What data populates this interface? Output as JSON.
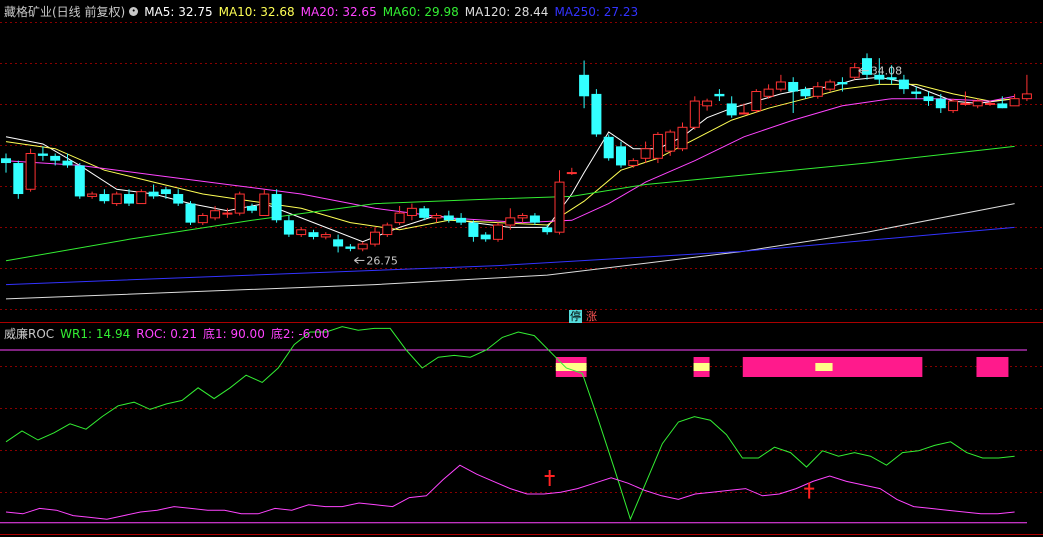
{
  "main_legend": {
    "title": "藏格矿业(日线 前复权)",
    "items": [
      {
        "label": "MA5: 32.75",
        "color": "#ffffff"
      },
      {
        "label": "MA10: 32.68",
        "color": "#ffff55"
      },
      {
        "label": "MA20: 32.65",
        "color": "#ff44ff"
      },
      {
        "label": "MA60: 29.98",
        "color": "#33ee33"
      },
      {
        "label": "MA120: 28.44",
        "color": "#dddddd"
      },
      {
        "label": "MA250: 27.23",
        "color": "#3333ff"
      }
    ]
  },
  "sub_legend": {
    "title": "威廉ROC",
    "items": [
      {
        "label": "WR1: 14.94",
        "color": "#33ee33"
      },
      {
        "label": "ROC: 0.21",
        "color": "#ff44ff"
      },
      {
        "label": "底1: 90.00",
        "color": "#ff44ff"
      },
      {
        "label": "底2: -6.00",
        "color": "#ff44ff"
      }
    ]
  },
  "badges": {
    "ting": "停",
    "zhang": "涨"
  },
  "annotations": {
    "high_label": "34.08",
    "low_label": "26.75"
  },
  "colors": {
    "up": "#ff3333",
    "down": "#33ffff",
    "grid": "#880000",
    "bg": "#000000"
  },
  "chart_data": [
    {
      "type": "candlestick",
      "title": "藏格矿业(日线 前复权)",
      "ylim": [
        24.0,
        36.5
      ],
      "candles": [
        [
          30.7,
          30.9,
          30.1,
          30.5
        ],
        [
          30.5,
          30.6,
          29.0,
          29.2
        ],
        [
          29.4,
          31.1,
          29.3,
          30.9
        ],
        [
          30.9,
          31.2,
          30.6,
          30.8
        ],
        [
          30.8,
          30.9,
          30.4,
          30.6
        ],
        [
          30.6,
          30.9,
          30.3,
          30.4
        ],
        [
          30.4,
          30.5,
          29.0,
          29.1
        ],
        [
          29.1,
          29.3,
          29.0,
          29.2
        ],
        [
          29.2,
          29.4,
          28.8,
          28.9
        ],
        [
          28.8,
          29.3,
          28.7,
          29.2
        ],
        [
          29.2,
          29.4,
          28.7,
          28.8
        ],
        [
          28.8,
          29.4,
          28.8,
          29.3
        ],
        [
          29.3,
          29.6,
          29.0,
          29.1
        ],
        [
          29.4,
          29.5,
          29.0,
          29.2
        ],
        [
          29.2,
          29.4,
          28.7,
          28.8
        ],
        [
          28.8,
          28.9,
          27.9,
          28.0
        ],
        [
          28.0,
          28.4,
          27.9,
          28.3
        ],
        [
          28.2,
          28.7,
          28.1,
          28.5
        ],
        [
          28.4,
          28.6,
          28.2,
          28.4
        ],
        [
          28.4,
          29.3,
          28.3,
          29.2
        ],
        [
          28.7,
          28.8,
          28.4,
          28.5
        ],
        [
          28.3,
          29.4,
          28.3,
          29.2
        ],
        [
          29.2,
          29.4,
          28.0,
          28.1
        ],
        [
          28.1,
          28.3,
          27.4,
          27.5
        ],
        [
          27.5,
          27.8,
          27.4,
          27.7
        ],
        [
          27.6,
          27.7,
          27.3,
          27.4
        ],
        [
          27.4,
          27.6,
          27.3,
          27.5
        ],
        [
          27.3,
          27.5,
          26.75,
          27.0
        ],
        [
          27.0,
          27.1,
          26.8,
          26.9
        ],
        [
          26.9,
          27.2,
          26.8,
          27.1
        ],
        [
          27.1,
          27.8,
          27.0,
          27.6
        ],
        [
          27.5,
          28.0,
          27.4,
          27.9
        ],
        [
          28.0,
          28.7,
          27.9,
          28.4
        ],
        [
          28.3,
          28.8,
          28.1,
          28.6
        ],
        [
          28.6,
          28.7,
          28.1,
          28.2
        ],
        [
          28.2,
          28.4,
          28.0,
          28.3
        ],
        [
          28.3,
          28.5,
          28.0,
          28.1
        ],
        [
          28.2,
          28.4,
          27.9,
          28.0
        ],
        [
          28.0,
          28.1,
          27.2,
          27.4
        ],
        [
          27.5,
          27.6,
          27.2,
          27.3
        ],
        [
          27.3,
          28.0,
          27.2,
          27.9
        ],
        [
          27.9,
          28.6,
          27.7,
          28.2
        ],
        [
          28.2,
          28.4,
          28.0,
          28.3
        ],
        [
          28.3,
          28.4,
          27.9,
          28.0
        ],
        [
          27.8,
          27.9,
          27.5,
          27.6
        ],
        [
          27.6,
          30.2,
          27.5,
          29.7
        ],
        [
          30.1,
          30.3,
          30.0,
          30.1
        ],
        [
          34.2,
          34.8,
          32.8,
          33.3
        ],
        [
          33.4,
          33.6,
          31.6,
          31.7
        ],
        [
          31.6,
          31.7,
          30.6,
          30.7
        ],
        [
          31.2,
          31.4,
          30.3,
          30.4
        ],
        [
          30.4,
          30.7,
          30.3,
          30.6
        ],
        [
          30.7,
          31.4,
          30.5,
          31.1
        ],
        [
          30.7,
          31.8,
          30.5,
          31.7
        ],
        [
          31.0,
          31.9,
          30.8,
          31.8
        ],
        [
          31.1,
          32.2,
          31.0,
          32.0
        ],
        [
          32.0,
          33.3,
          31.9,
          33.1
        ],
        [
          32.9,
          33.2,
          32.7,
          33.1
        ],
        [
          33.4,
          33.6,
          33.1,
          33.3
        ],
        [
          33.0,
          33.3,
          32.4,
          32.5
        ],
        [
          32.6,
          33.0,
          32.6,
          32.6
        ],
        [
          32.7,
          33.6,
          32.6,
          33.5
        ],
        [
          33.3,
          33.8,
          33.2,
          33.6
        ],
        [
          33.6,
          34.2,
          33.5,
          33.9
        ],
        [
          33.9,
          34.1,
          32.6,
          33.5
        ],
        [
          33.6,
          33.7,
          33.2,
          33.3
        ],
        [
          33.3,
          33.9,
          33.2,
          33.7
        ],
        [
          33.6,
          34.0,
          33.5,
          33.9
        ],
        [
          33.9,
          34.1,
          33.5,
          33.8
        ],
        [
          34.1,
          34.7,
          34.0,
          34.5
        ],
        [
          34.9,
          35.1,
          34.0,
          34.2
        ],
        [
          34.2,
          34.9,
          33.8,
          34.0
        ],
        [
          34.1,
          34.6,
          33.8,
          34.0
        ],
        [
          34.0,
          34.2,
          33.4,
          33.6
        ],
        [
          33.5,
          33.7,
          33.2,
          33.4
        ],
        [
          33.3,
          33.5,
          32.9,
          33.1
        ],
        [
          33.2,
          33.4,
          32.6,
          32.8
        ],
        [
          32.7,
          33.2,
          32.6,
          33.1
        ],
        [
          33.0,
          33.5,
          32.9,
          33.0
        ],
        [
          32.9,
          33.2,
          32.8,
          33.1
        ],
        [
          33.0,
          33.1,
          32.9,
          33.0
        ],
        [
          33.0,
          33.3,
          32.8,
          32.8
        ],
        [
          32.9,
          33.4,
          32.9,
          33.2
        ],
        [
          33.2,
          34.2,
          33.1,
          33.4
        ]
      ],
      "ma": {
        "MA5": {
          "start": [
            30.9,
            30.3
          ],
          "end": [
            33.2,
            32.9
          ],
          "points": [
            [
              0,
              31.6
            ],
            [
              3,
              31.3
            ],
            [
              6,
              30.4
            ],
            [
              9,
              29.4
            ],
            [
              12,
              29.2
            ],
            [
              15,
              28.8
            ],
            [
              18,
              28.5
            ],
            [
              21,
              28.8
            ],
            [
              23,
              28.4
            ],
            [
              26,
              27.8
            ],
            [
              29,
              27.2
            ],
            [
              32,
              27.8
            ],
            [
              35,
              28.3
            ],
            [
              38,
              28.0
            ],
            [
              41,
              27.8
            ],
            [
              44,
              27.8
            ],
            [
              46,
              29.2
            ],
            [
              47,
              30.1
            ],
            [
              49,
              31.8
            ],
            [
              51,
              31.1
            ],
            [
              53,
              31.1
            ],
            [
              55,
              31.6
            ],
            [
              57,
              32.4
            ],
            [
              59,
              32.8
            ],
            [
              61,
              33.1
            ],
            [
              63,
              33.4
            ],
            [
              65,
              33.6
            ],
            [
              67,
              33.7
            ],
            [
              69,
              34.0
            ],
            [
              71,
              34.1
            ],
            [
              73,
              33.9
            ],
            [
              75,
              33.5
            ],
            [
              77,
              33.1
            ],
            [
              79,
              33.0
            ],
            [
              82,
              33.2
            ]
          ]
        },
        "MA10": {
          "points": [
            [
              0,
              31.4
            ],
            [
              4,
              31.1
            ],
            [
              8,
              30.2
            ],
            [
              12,
              29.7
            ],
            [
              16,
              29.2
            ],
            [
              20,
              28.9
            ],
            [
              24,
              28.6
            ],
            [
              28,
              28.0
            ],
            [
              32,
              27.7
            ],
            [
              36,
              28.1
            ],
            [
              40,
              28.0
            ],
            [
              44,
              27.9
            ],
            [
              47,
              28.9
            ],
            [
              50,
              30.2
            ],
            [
              53,
              30.7
            ],
            [
              56,
              31.5
            ],
            [
              59,
              32.3
            ],
            [
              62,
              32.8
            ],
            [
              65,
              33.2
            ],
            [
              68,
              33.6
            ],
            [
              71,
              33.8
            ],
            [
              74,
              33.8
            ],
            [
              77,
              33.4
            ],
            [
              80,
              33.1
            ],
            [
              82,
              33.2
            ]
          ]
        },
        "MA20": {
          "points": [
            [
              0,
              30.6
            ],
            [
              6,
              30.4
            ],
            [
              12,
              30.0
            ],
            [
              18,
              29.6
            ],
            [
              24,
              29.2
            ],
            [
              30,
              28.6
            ],
            [
              36,
              28.2
            ],
            [
              42,
              28.0
            ],
            [
              46,
              28.1
            ],
            [
              49,
              28.8
            ],
            [
              52,
              29.7
            ],
            [
              56,
              30.6
            ],
            [
              60,
              31.6
            ],
            [
              64,
              32.3
            ],
            [
              68,
              32.9
            ],
            [
              72,
              33.2
            ],
            [
              76,
              33.2
            ],
            [
              80,
              33.1
            ],
            [
              82,
              33.3
            ]
          ]
        },
        "MA60": {
          "points": [
            [
              0,
              26.4
            ],
            [
              10,
              27.3
            ],
            [
              20,
              28.1
            ],
            [
              30,
              28.8
            ],
            [
              40,
              29.0
            ],
            [
              46,
              29.1
            ],
            [
              52,
              29.6
            ],
            [
              60,
              30.0
            ],
            [
              70,
              30.5
            ],
            [
              82,
              31.2
            ]
          ]
        },
        "MA120": {
          "points": [
            [
              0,
              24.8
            ],
            [
              15,
              25.1
            ],
            [
              30,
              25.4
            ],
            [
              44,
              25.8
            ],
            [
              52,
              26.3
            ],
            [
              60,
              26.8
            ],
            [
              70,
              27.6
            ],
            [
              82,
              28.8
            ]
          ]
        },
        "MA250": {
          "points": [
            [
              0,
              25.4
            ],
            [
              20,
              25.8
            ],
            [
              40,
              26.2
            ],
            [
              60,
              26.8
            ],
            [
              82,
              27.8
            ]
          ]
        }
      },
      "high_label": {
        "index": 69,
        "value": 34.08
      },
      "low_label": {
        "index": 28,
        "value": 26.75
      },
      "markers": [
        {
          "index": 48,
          "text": "停"
        },
        {
          "index": 49,
          "text": "涨"
        }
      ]
    },
    {
      "type": "line",
      "title": "威廉ROC",
      "ylim": [
        -10,
        100
      ],
      "series": [
        {
          "name": "WR1",
          "color": "#33ee33",
          "values": [
            39,
            45,
            40,
            44,
            49,
            46,
            53,
            59,
            61,
            57,
            60,
            62,
            69,
            63,
            69,
            76,
            72,
            80,
            93,
            100,
            100,
            103,
            101,
            102,
            102,
            90,
            80,
            86,
            87,
            86,
            90,
            97,
            100,
            98,
            89,
            80,
            77,
            51,
            24,
            -4,
            17,
            38,
            50,
            53,
            51,
            43,
            30,
            30,
            36,
            33,
            25,
            34,
            31,
            33,
            31,
            26,
            33,
            34,
            37,
            39,
            33,
            30,
            30,
            31
          ]
        },
        {
          "name": "ROC",
          "color": "#ff44ff",
          "values": [
            0,
            -1,
            2,
            1,
            -2,
            -3,
            -4,
            -2,
            0,
            1,
            3,
            2,
            1,
            1,
            -1,
            -1,
            2,
            1,
            4,
            3,
            3,
            5,
            4,
            3,
            8,
            9,
            18,
            26,
            21,
            17,
            13,
            10,
            10,
            11,
            13,
            16,
            19,
            16,
            12,
            9,
            7,
            10,
            11,
            12,
            13,
            9,
            10,
            13,
            17,
            20,
            17,
            15,
            13,
            7,
            3,
            2,
            1,
            0,
            -1,
            -1,
            0
          ]
        },
        {
          "name": "底1",
          "color": "#ff44ff",
          "values": [
            90
          ]
        },
        {
          "name": "底2",
          "color": "#ff44ff",
          "values": [
            -6
          ]
        }
      ],
      "signal_bars": [
        {
          "from": 44.7,
          "to": 47.2,
          "highlight": [
            44.7,
            47.2
          ]
        },
        {
          "from": 55.9,
          "to": 57.2,
          "highlight": [
            55.9,
            57.2
          ]
        },
        {
          "from": 59.9,
          "to": 74.5,
          "highlight": [
            65.8,
            67.2
          ]
        },
        {
          "from": 78.9,
          "to": 81.5,
          "highlight": null
        }
      ],
      "buy_markers": [
        {
          "x": 44.2,
          "value": 20
        },
        {
          "x": 65.3,
          "value": 13
        }
      ]
    }
  ]
}
